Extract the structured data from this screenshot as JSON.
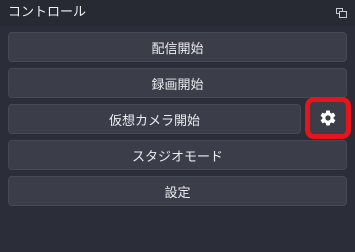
{
  "panel": {
    "title": "コントロール",
    "float_icon": "undock-icon"
  },
  "buttons": {
    "start_streaming": "配信開始",
    "start_recording": "録画開始",
    "start_virtual_camera": "仮想カメラ開始",
    "studio_mode": "スタジオモード",
    "settings": "設定"
  },
  "virtual_camera_settings": {
    "icon": "gear-icon",
    "highlight_color": "#e8141c"
  }
}
